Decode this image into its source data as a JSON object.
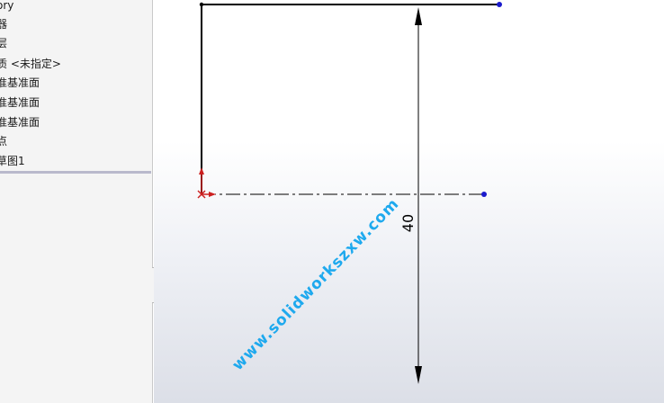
{
  "feature_tree": {
    "items": [
      {
        "label": "ory"
      },
      {
        "label": "器"
      },
      {
        "label": "层"
      },
      {
        "label": "质 <未指定>"
      },
      {
        "label": "准基准面"
      },
      {
        "label": "准基准面"
      },
      {
        "label": "准基准面"
      },
      {
        "label": "点"
      },
      {
        "label": "草图1"
      }
    ]
  },
  "sketch": {
    "dimension_value": "40",
    "colors": {
      "line": "#000000",
      "endpoint": "#1a1acc",
      "origin": "#cc2020",
      "centerline": "#000000"
    }
  },
  "watermark": {
    "text": "www.solidworkszxw.com",
    "color": "#1ea9ee"
  }
}
